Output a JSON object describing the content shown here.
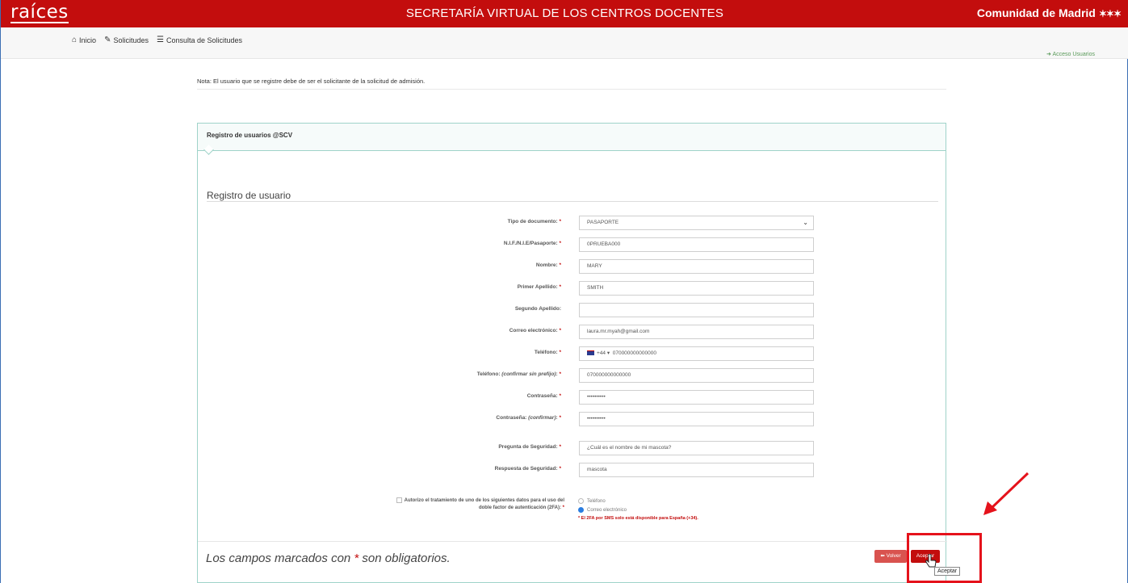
{
  "header": {
    "logo": "raíces",
    "title": "SECRETARÍA VIRTUAL DE LOS CENTROS DOCENTES",
    "brand": "Comunidad de Madrid",
    "brand_icon": "madrid-stars-icon"
  },
  "nav": {
    "items": [
      {
        "label": "Inicio",
        "icon": "home-icon"
      },
      {
        "label": "Solicitudes",
        "icon": "pencil-icon"
      },
      {
        "label": "Consulta de Solicitudes",
        "icon": "list-icon"
      }
    ],
    "access": "Acceso Usuarios"
  },
  "note": "Nota: El usuario que se registre debe de ser el solicitante de la solicitud de admisión.",
  "panel": {
    "heading": "Registro de usuarios @SCV",
    "section_title": "Registro de usuario"
  },
  "form": {
    "tipo_documento": {
      "label": "Tipo de documento:",
      "value": "PASAPORTE"
    },
    "documento": {
      "label": "N.I.F./N.I.E/Pasaporte:",
      "value": "0PRUEBA000"
    },
    "nombre": {
      "label": "Nombre:",
      "value": "MARY"
    },
    "primer_apellido": {
      "label": "Primer Apellido:",
      "value": "SMITH"
    },
    "segundo_apellido": {
      "label": "Segundo Apellido:",
      "value": ""
    },
    "correo": {
      "label": "Correo electrónico:",
      "value": "laura.mr.myah@gmail.com"
    },
    "telefono": {
      "label": "Teléfono:",
      "prefix": "+44",
      "value": "070000000000000"
    },
    "telefono_confirm": {
      "label": "Teléfono:",
      "label_em": "(confirmar sin prefijo)",
      "value": "070000000000000"
    },
    "contrasena": {
      "label": "Contraseña:",
      "value": "••••••••••"
    },
    "contrasena_confirm": {
      "label": "Contraseña:",
      "label_em": "(confirmar)",
      "value": "••••••••••"
    },
    "pregunta": {
      "label": "Pregunta de Seguridad:",
      "value": "¿Cuál es el nombre de mi mascota?"
    },
    "respuesta": {
      "label": "Respuesta de Seguridad:",
      "value": "mascota"
    },
    "required_mark": "*",
    "auth": {
      "label_line1": "Autorizo el tratamiento de uno de los siguientes datos para el uso del",
      "label_line2": "doble factor de autenticación (2FA):",
      "options": [
        {
          "label": "Teléfono",
          "selected": false
        },
        {
          "label": "Correo electrónico",
          "selected": true
        }
      ],
      "warning": "* El 2FA por SMS solo está disponible para España (+34)."
    }
  },
  "footer": {
    "required_note_prefix": "Los campos marcados con ",
    "required_note_star": "*",
    "required_note_suffix": " son obligatorios.",
    "volver_label": "Volver",
    "aceptar_label": "Aceptar",
    "tooltip": "Aceptar"
  },
  "colors": {
    "brand_red": "#c30d0d",
    "panel_border": "#9fd3c9",
    "annotation_red": "#e5121b"
  }
}
